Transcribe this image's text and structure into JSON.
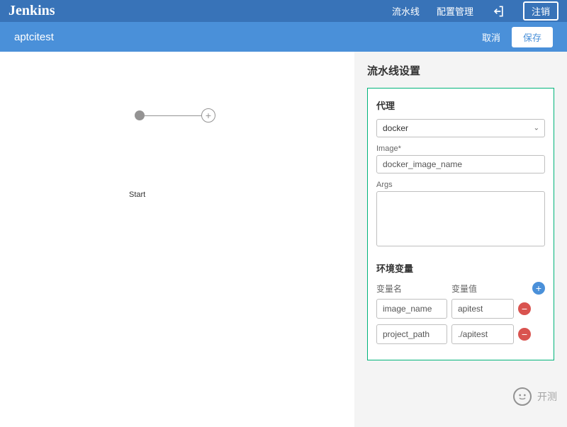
{
  "header": {
    "logo": "Jenkins",
    "nav": {
      "pipeline": "流水线",
      "config": "配置管理"
    },
    "logout": "注销"
  },
  "subheader": {
    "pipeline_name": "aptcitest",
    "cancel": "取消",
    "save": "保存"
  },
  "canvas": {
    "start_label": "Start",
    "add_symbol": "+"
  },
  "sidebar": {
    "title": "流水线设置",
    "agent": {
      "label": "代理",
      "selected": "docker",
      "image_label": "Image*",
      "image_value": "docker_image_name",
      "args_label": "Args",
      "args_value": ""
    },
    "env": {
      "label": "环境变量",
      "col_name": "变量名",
      "col_value": "变量值",
      "rows": [
        {
          "name": "image_name",
          "value": "apitest"
        },
        {
          "name": "project_path",
          "value": "./apitest"
        }
      ]
    }
  },
  "watermark": {
    "text": "开测"
  }
}
